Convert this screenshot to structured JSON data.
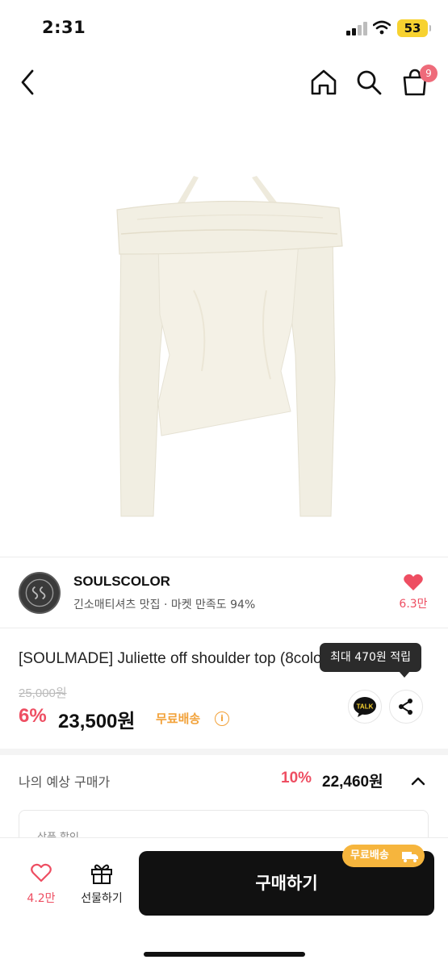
{
  "status_bar": {
    "time": "2:31",
    "battery": "53"
  },
  "nav": {
    "cart_count": "9",
    "icons": [
      "back-icon",
      "home-icon",
      "search-icon",
      "cart-icon"
    ]
  },
  "seller": {
    "name": "SOULSCOLOR",
    "description": "긴소매티셔츠 맛집 · 마켓 만족도 94%",
    "likes": "6.3만"
  },
  "product": {
    "title": "[SOULMADE] Juliette off shoulder top (8color)",
    "original_price": "25,000원",
    "discount_rate": "6%",
    "price": "23,500원",
    "free_shipping": "무료배송",
    "points_tooltip": "최대 470원 적립",
    "talk_label": "TALK"
  },
  "expected": {
    "label": "나의 예상 구매가",
    "discount_rate": "10%",
    "price": "22,460원",
    "box_label": "상품 할인"
  },
  "bottom_bar": {
    "likes": "4.2만",
    "gift_label": "선물하기",
    "buy_label": "구매하기",
    "shipping_badge": "무료배송"
  },
  "colors": {
    "accent_pink": "#ee4e62",
    "accent_orange": "#f2a23a",
    "button_dark": "#111111"
  }
}
